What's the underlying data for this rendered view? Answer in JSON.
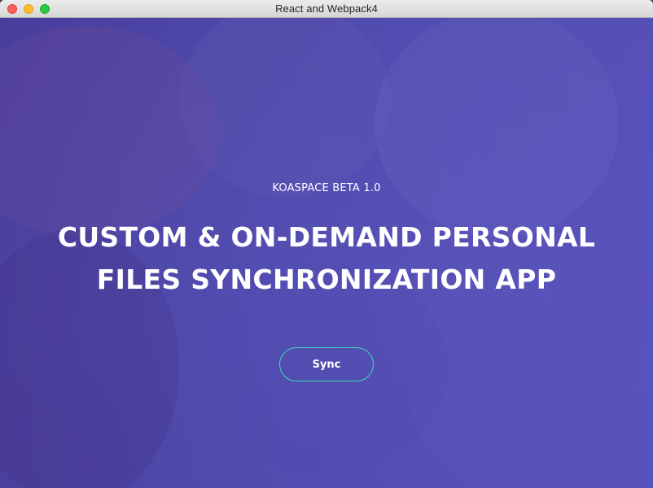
{
  "window": {
    "title": "React and Webpack4"
  },
  "hero": {
    "subtitle": "KOASPACE BETA 1.0",
    "headline_line1": "CUSTOM & ON-DEMAND PERSONAL",
    "headline_line2": "FILES SYNCHRONIZATION APP",
    "sync_label": "Sync"
  },
  "colors": {
    "background_primary": "#4f4aae",
    "button_border": "#3fd9b6",
    "text": "#ffffff"
  },
  "icons": [
    "close-icon",
    "minimize-icon",
    "maximize-icon"
  ]
}
